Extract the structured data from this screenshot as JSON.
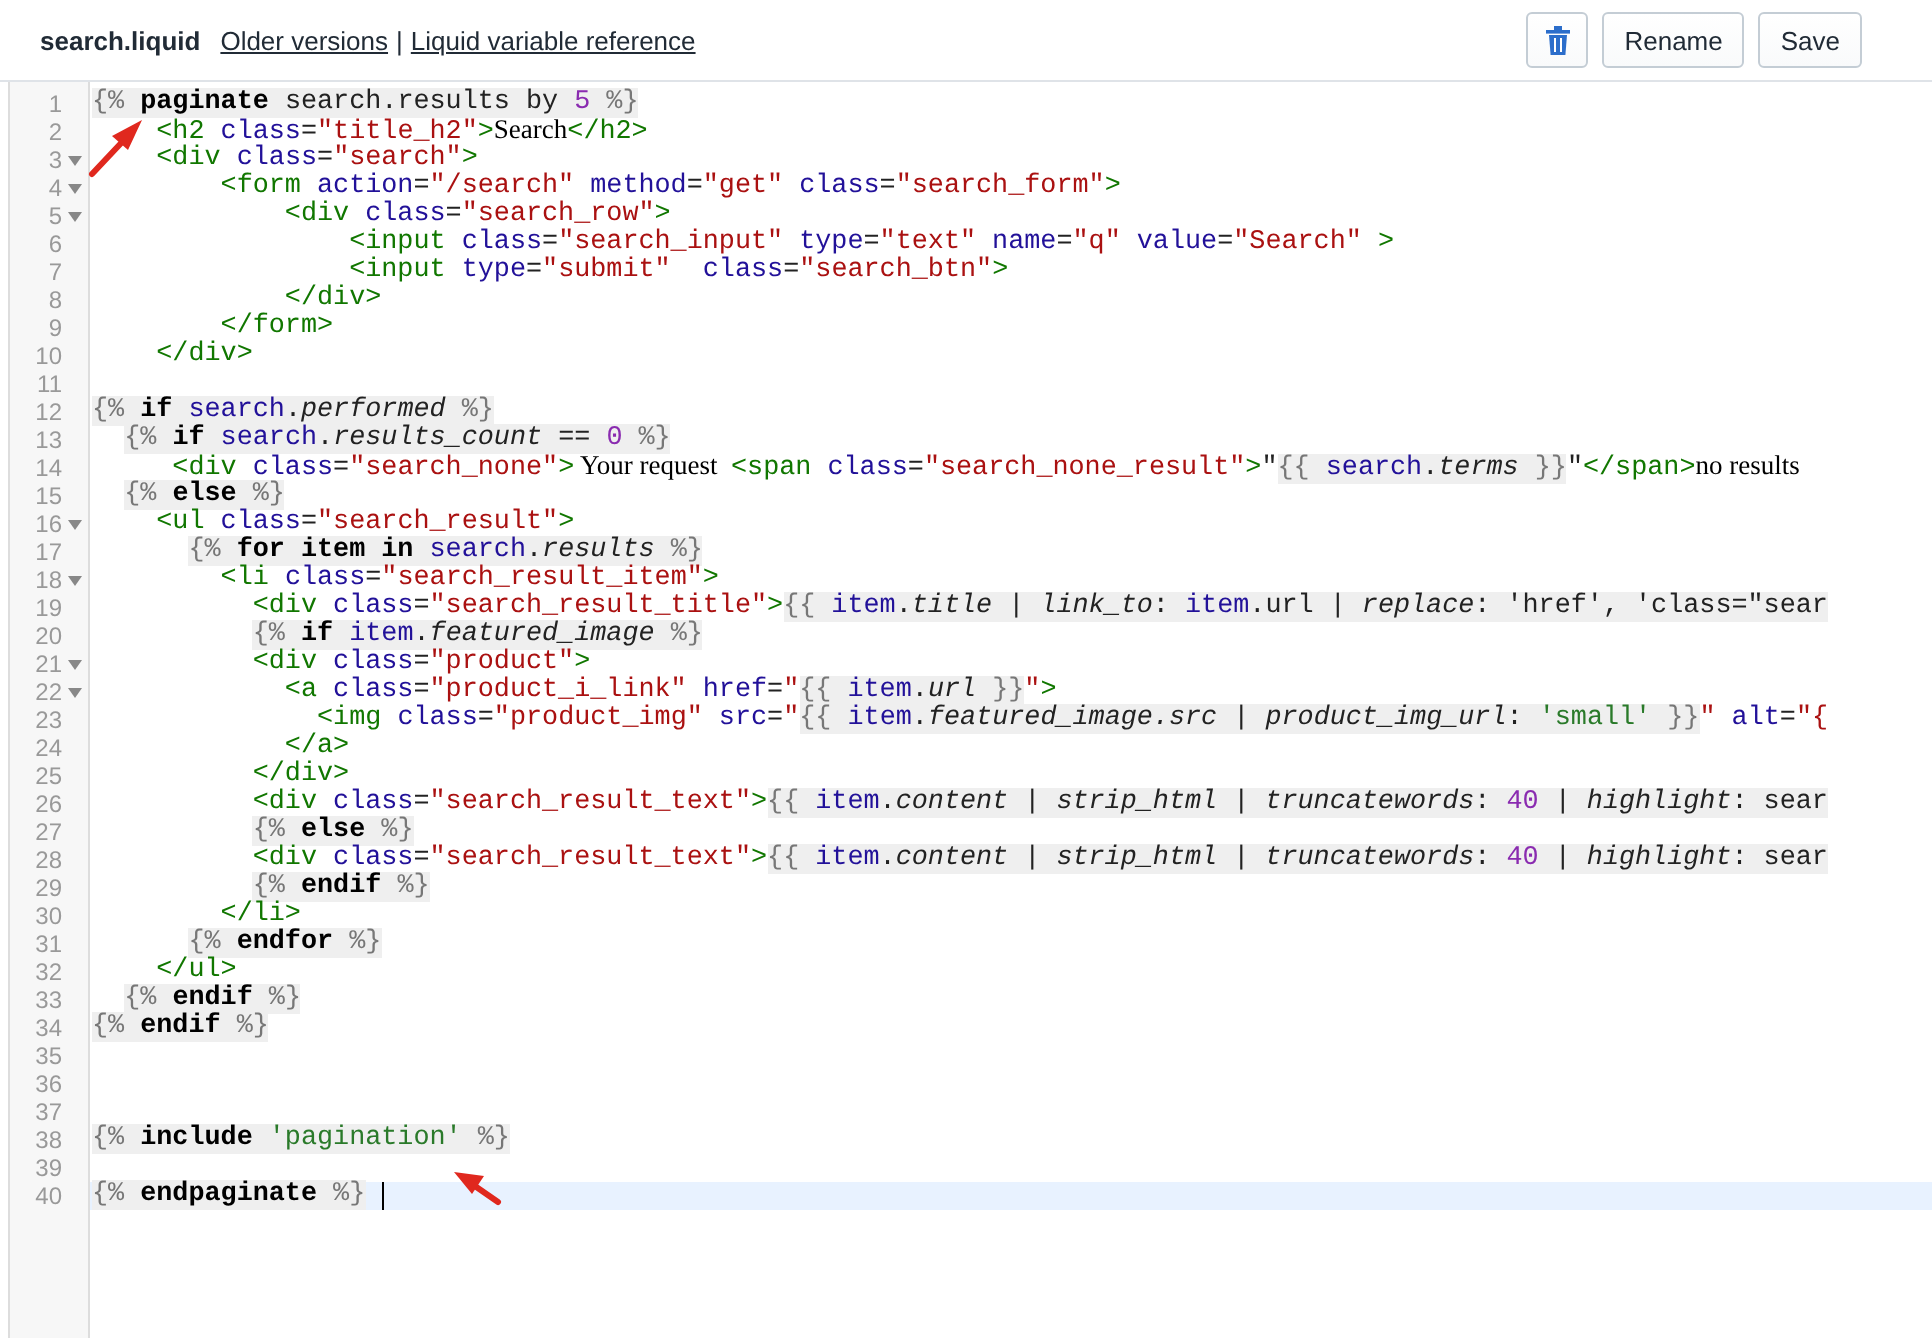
{
  "header": {
    "title": "search.liquid",
    "links": [
      {
        "label": "Older versions"
      },
      {
        "label": "Liquid variable reference"
      }
    ],
    "separator": "|",
    "buttons": [
      {
        "kind": "delete"
      },
      {
        "kind": "text",
        "label": "Rename"
      },
      {
        "kind": "text",
        "label": "Save"
      }
    ]
  },
  "editor": {
    "lines": [
      {
        "number": "1",
        "foldable": false,
        "current": false,
        "tokens": [
          {
            "kind": "block",
            "children": [
              {
                "kind": "lq",
                "text": "{% "
              },
              {
                "kind": "kw",
                "text": "paginate"
              },
              {
                "kind": "p",
                "text": " search.results by "
              },
              {
                "kind": "num",
                "text": "5"
              },
              {
                "kind": "lq",
                "text": " %}"
              }
            ]
          }
        ]
      },
      {
        "number": "2",
        "foldable": false,
        "current": false,
        "tokens": [
          {
            "kind": "tag",
            "text": "    <h2"
          },
          {
            "kind": "attr",
            "text": " class"
          },
          {
            "kind": "p",
            "text": "="
          },
          {
            "kind": "str",
            "text": "\"title_h2\""
          },
          {
            "kind": "tag",
            "text": ">"
          },
          {
            "kind": "text",
            "text": "Search"
          },
          {
            "kind": "tag",
            "text": "</h2>"
          }
        ]
      },
      {
        "number": "3",
        "foldable": true,
        "current": false,
        "tokens": [
          {
            "kind": "tag",
            "text": "    <div"
          },
          {
            "kind": "attr",
            "text": " class"
          },
          {
            "kind": "p",
            "text": "="
          },
          {
            "kind": "str",
            "text": "\"search\""
          },
          {
            "kind": "tag",
            "text": ">"
          }
        ]
      },
      {
        "number": "4",
        "foldable": true,
        "current": false,
        "tokens": [
          {
            "kind": "tag",
            "text": "        <form"
          },
          {
            "kind": "attr",
            "text": " action"
          },
          {
            "kind": "p",
            "text": "="
          },
          {
            "kind": "str",
            "text": "\"/search\""
          },
          {
            "kind": "attr",
            "text": " method"
          },
          {
            "kind": "p",
            "text": "="
          },
          {
            "kind": "str",
            "text": "\"get\""
          },
          {
            "kind": "attr",
            "text": " class"
          },
          {
            "kind": "p",
            "text": "="
          },
          {
            "kind": "str",
            "text": "\"search_form\""
          },
          {
            "kind": "tag",
            "text": ">"
          }
        ]
      },
      {
        "number": "5",
        "foldable": true,
        "current": false,
        "tokens": [
          {
            "kind": "tag",
            "text": "            <div"
          },
          {
            "kind": "attr",
            "text": " class"
          },
          {
            "kind": "p",
            "text": "="
          },
          {
            "kind": "str",
            "text": "\"search_row\""
          },
          {
            "kind": "tag",
            "text": ">"
          }
        ]
      },
      {
        "number": "6",
        "foldable": false,
        "current": false,
        "tokens": [
          {
            "kind": "tag",
            "text": "                <input"
          },
          {
            "kind": "attr",
            "text": " class"
          },
          {
            "kind": "p",
            "text": "="
          },
          {
            "kind": "str",
            "text": "\"search_input\""
          },
          {
            "kind": "attr",
            "text": " type"
          },
          {
            "kind": "p",
            "text": "="
          },
          {
            "kind": "str",
            "text": "\"text\""
          },
          {
            "kind": "attr",
            "text": " name"
          },
          {
            "kind": "p",
            "text": "="
          },
          {
            "kind": "str",
            "text": "\"q\""
          },
          {
            "kind": "attr",
            "text": " value"
          },
          {
            "kind": "p",
            "text": "="
          },
          {
            "kind": "str",
            "text": "\"Search\""
          },
          {
            "kind": "tag",
            "text": " >"
          }
        ]
      },
      {
        "number": "7",
        "foldable": false,
        "current": false,
        "tokens": [
          {
            "kind": "tag",
            "text": "                <input"
          },
          {
            "kind": "attr",
            "text": " type"
          },
          {
            "kind": "p",
            "text": "="
          },
          {
            "kind": "str",
            "text": "\"submit\""
          },
          {
            "kind": "attr",
            "text": "  class"
          },
          {
            "kind": "p",
            "text": "="
          },
          {
            "kind": "str",
            "text": "\"search_btn\""
          },
          {
            "kind": "tag",
            "text": ">"
          }
        ]
      },
      {
        "number": "8",
        "foldable": false,
        "current": false,
        "tokens": [
          {
            "kind": "tag",
            "text": "            </div>"
          }
        ]
      },
      {
        "number": "9",
        "foldable": false,
        "current": false,
        "tokens": [
          {
            "kind": "tag",
            "text": "        </form>"
          }
        ]
      },
      {
        "number": "10",
        "foldable": false,
        "current": false,
        "tokens": [
          {
            "kind": "tag",
            "text": "    </div>"
          }
        ]
      },
      {
        "number": "11",
        "foldable": false,
        "current": false
      },
      {
        "number": "12",
        "foldable": false,
        "current": false,
        "tokens": [
          {
            "kind": "block",
            "children": [
              {
                "kind": "lq",
                "text": "{% "
              },
              {
                "kind": "kw",
                "text": "if"
              },
              {
                "kind": "var",
                "text": " search"
              },
              {
                "kind": "p",
                "text": "."
              },
              {
                "kind": "prop",
                "text": "performed"
              },
              {
                "kind": "lq",
                "text": " %}"
              }
            ]
          }
        ]
      },
      {
        "number": "13",
        "foldable": false,
        "current": false,
        "tokens": [
          {
            "kind": "block",
            "children": [
              {
                "kind": "lq",
                "text": "  {% "
              },
              {
                "kind": "kw",
                "text": "if"
              },
              {
                "kind": "var",
                "text": " search"
              },
              {
                "kind": "p",
                "text": "."
              },
              {
                "kind": "prop",
                "text": "results_count"
              },
              {
                "kind": "p",
                "text": " == "
              },
              {
                "kind": "num",
                "text": "0"
              },
              {
                "kind": "lq",
                "text": " %}"
              }
            ]
          }
        ]
      },
      {
        "number": "14",
        "foldable": false,
        "current": false,
        "tokens": [
          {
            "kind": "tag",
            "text": "     <div"
          },
          {
            "kind": "attr",
            "text": " class"
          },
          {
            "kind": "p",
            "text": "="
          },
          {
            "kind": "str",
            "text": "\"search_none\""
          },
          {
            "kind": "tag",
            "text": ">"
          },
          {
            "kind": "text",
            "text": " Your request  "
          },
          {
            "kind": "tag",
            "text": "<span"
          },
          {
            "kind": "attr",
            "text": " class"
          },
          {
            "kind": "p",
            "text": "="
          },
          {
            "kind": "str",
            "text": "\"search_none_result\""
          },
          {
            "kind": "tag",
            "text": ">"
          },
          {
            "kind": "p",
            "text": "\""
          },
          {
            "kind": "block",
            "children": [
              {
                "kind": "lq",
                "text": "{{ "
              },
              {
                "kind": "var",
                "text": "search"
              },
              {
                "kind": "p",
                "text": "."
              },
              {
                "kind": "prop",
                "text": "terms"
              },
              {
                "kind": "lq",
                "text": " }}"
              }
            ]
          },
          {
            "kind": "p",
            "text": "\""
          },
          {
            "kind": "tag",
            "text": "</span>"
          },
          {
            "kind": "text",
            "text": "no results"
          }
        ]
      },
      {
        "number": "15",
        "foldable": false,
        "current": false,
        "tokens": [
          {
            "kind": "block",
            "children": [
              {
                "kind": "lq",
                "text": "  {% "
              },
              {
                "kind": "kw",
                "text": "else"
              },
              {
                "kind": "lq",
                "text": " %}"
              }
            ]
          }
        ]
      },
      {
        "number": "16",
        "foldable": true,
        "current": false,
        "tokens": [
          {
            "kind": "tag",
            "text": "    <ul"
          },
          {
            "kind": "attr",
            "text": " class"
          },
          {
            "kind": "p",
            "text": "="
          },
          {
            "kind": "str",
            "text": "\"search_result\""
          },
          {
            "kind": "tag",
            "text": ">"
          }
        ]
      },
      {
        "number": "17",
        "foldable": false,
        "current": false,
        "tokens": [
          {
            "kind": "block",
            "children": [
              {
                "kind": "lq",
                "text": "      {% "
              },
              {
                "kind": "kw",
                "text": "for item in"
              },
              {
                "kind": "var",
                "text": " search"
              },
              {
                "kind": "p",
                "text": "."
              },
              {
                "kind": "prop",
                "text": "results"
              },
              {
                "kind": "lq",
                "text": " %}"
              }
            ]
          }
        ]
      },
      {
        "number": "18",
        "foldable": true,
        "current": false,
        "tokens": [
          {
            "kind": "tag",
            "text": "        <li"
          },
          {
            "kind": "attr",
            "text": " class"
          },
          {
            "kind": "p",
            "text": "="
          },
          {
            "kind": "str",
            "text": "\"search_result_item\""
          },
          {
            "kind": "tag",
            "text": ">"
          }
        ]
      },
      {
        "number": "19",
        "foldable": false,
        "current": false,
        "tokens": [
          {
            "kind": "tag",
            "text": "          <div"
          },
          {
            "kind": "attr",
            "text": " class"
          },
          {
            "kind": "p",
            "text": "="
          },
          {
            "kind": "str",
            "text": "\"search_result_title\""
          },
          {
            "kind": "tag",
            "text": ">"
          },
          {
            "kind": "block",
            "children": [
              {
                "kind": "lq",
                "text": "{{ "
              },
              {
                "kind": "var",
                "text": "item"
              },
              {
                "kind": "p",
                "text": "."
              },
              {
                "kind": "prop",
                "text": "title"
              },
              {
                "kind": "p",
                "text": " | "
              },
              {
                "kind": "prop",
                "text": "link_to"
              },
              {
                "kind": "p",
                "text": ": "
              },
              {
                "kind": "var",
                "text": "item"
              },
              {
                "kind": "p",
                "text": ".url | "
              },
              {
                "kind": "prop",
                "text": "replace"
              },
              {
                "kind": "p",
                "text": ": 'href', 'class=\"sear"
              }
            ]
          }
        ]
      },
      {
        "number": "20",
        "foldable": false,
        "current": false,
        "tokens": [
          {
            "kind": "block",
            "children": [
              {
                "kind": "lq",
                "text": "          {% "
              },
              {
                "kind": "kw",
                "text": "if"
              },
              {
                "kind": "var",
                "text": " item"
              },
              {
                "kind": "p",
                "text": "."
              },
              {
                "kind": "prop",
                "text": "featured_image"
              },
              {
                "kind": "lq",
                "text": " %}"
              }
            ]
          }
        ]
      },
      {
        "number": "21",
        "foldable": true,
        "current": false,
        "tokens": [
          {
            "kind": "tag",
            "text": "          <div"
          },
          {
            "kind": "attr",
            "text": " class"
          },
          {
            "kind": "p",
            "text": "="
          },
          {
            "kind": "str",
            "text": "\"product\""
          },
          {
            "kind": "tag",
            "text": ">"
          }
        ]
      },
      {
        "number": "22",
        "foldable": true,
        "current": false,
        "tokens": [
          {
            "kind": "tag",
            "text": "            <a"
          },
          {
            "kind": "attr",
            "text": " class"
          },
          {
            "kind": "p",
            "text": "="
          },
          {
            "kind": "str",
            "text": "\"product_i_link\""
          },
          {
            "kind": "attr",
            "text": " href"
          },
          {
            "kind": "p",
            "text": "="
          },
          {
            "kind": "str",
            "text": "\""
          },
          {
            "kind": "block",
            "children": [
              {
                "kind": "lq",
                "text": "{{ "
              },
              {
                "kind": "var",
                "text": "item"
              },
              {
                "kind": "p",
                "text": "."
              },
              {
                "kind": "prop",
                "text": "url"
              },
              {
                "kind": "lq",
                "text": " }}"
              }
            ]
          },
          {
            "kind": "str",
            "text": "\""
          },
          {
            "kind": "tag",
            "text": ">"
          }
        ]
      },
      {
        "number": "23",
        "foldable": false,
        "current": false,
        "tokens": [
          {
            "kind": "tag",
            "text": "              <img"
          },
          {
            "kind": "attr",
            "text": " class"
          },
          {
            "kind": "p",
            "text": "="
          },
          {
            "kind": "str",
            "text": "\"product_img\""
          },
          {
            "kind": "attr",
            "text": " src"
          },
          {
            "kind": "p",
            "text": "="
          },
          {
            "kind": "str",
            "text": "\""
          },
          {
            "kind": "block",
            "children": [
              {
                "kind": "lq",
                "text": "{{ "
              },
              {
                "kind": "var",
                "text": "item"
              },
              {
                "kind": "p",
                "text": "."
              },
              {
                "kind": "prop",
                "text": "featured_image.src"
              },
              {
                "kind": "p",
                "text": " | "
              },
              {
                "kind": "prop",
                "text": "product_img_url"
              },
              {
                "kind": "p",
                "text": ": "
              },
              {
                "kind": "lstr",
                "text": "'small'"
              },
              {
                "kind": "lq",
                "text": " }}"
              }
            ]
          },
          {
            "kind": "str",
            "text": "\""
          },
          {
            "kind": "attr",
            "text": " alt"
          },
          {
            "kind": "p",
            "text": "="
          },
          {
            "kind": "str",
            "text": "\"{"
          }
        ]
      },
      {
        "number": "24",
        "foldable": false,
        "current": false,
        "tokens": [
          {
            "kind": "tag",
            "text": "            </a>"
          }
        ]
      },
      {
        "number": "25",
        "foldable": false,
        "current": false,
        "tokens": [
          {
            "kind": "tag",
            "text": "          </div>"
          }
        ]
      },
      {
        "number": "26",
        "foldable": false,
        "current": false,
        "tokens": [
          {
            "kind": "tag",
            "text": "          <div"
          },
          {
            "kind": "attr",
            "text": " class"
          },
          {
            "kind": "p",
            "text": "="
          },
          {
            "kind": "str",
            "text": "\"search_result_text\""
          },
          {
            "kind": "tag",
            "text": ">"
          },
          {
            "kind": "block",
            "children": [
              {
                "kind": "lq",
                "text": "{{ "
              },
              {
                "kind": "var",
                "text": "item"
              },
              {
                "kind": "p",
                "text": "."
              },
              {
                "kind": "prop",
                "text": "content"
              },
              {
                "kind": "p",
                "text": " | "
              },
              {
                "kind": "prop",
                "text": "strip_html"
              },
              {
                "kind": "p",
                "text": " | "
              },
              {
                "kind": "prop",
                "text": "truncatewords"
              },
              {
                "kind": "p",
                "text": ": "
              },
              {
                "kind": "num",
                "text": "40"
              },
              {
                "kind": "p",
                "text": " | "
              },
              {
                "kind": "prop",
                "text": "highlight"
              },
              {
                "kind": "p",
                "text": ": sear"
              }
            ]
          }
        ]
      },
      {
        "number": "27",
        "foldable": false,
        "current": false,
        "tokens": [
          {
            "kind": "block",
            "children": [
              {
                "kind": "lq",
                "text": "          {% "
              },
              {
                "kind": "kw",
                "text": "else"
              },
              {
                "kind": "lq",
                "text": " %}"
              }
            ]
          }
        ]
      },
      {
        "number": "28",
        "foldable": false,
        "current": false,
        "tokens": [
          {
            "kind": "tag",
            "text": "          <div"
          },
          {
            "kind": "attr",
            "text": " class"
          },
          {
            "kind": "p",
            "text": "="
          },
          {
            "kind": "str",
            "text": "\"search_result_text\""
          },
          {
            "kind": "tag",
            "text": ">"
          },
          {
            "kind": "block",
            "children": [
              {
                "kind": "lq",
                "text": "{{ "
              },
              {
                "kind": "var",
                "text": "item"
              },
              {
                "kind": "p",
                "text": "."
              },
              {
                "kind": "prop",
                "text": "content"
              },
              {
                "kind": "p",
                "text": " | "
              },
              {
                "kind": "prop",
                "text": "strip_html"
              },
              {
                "kind": "p",
                "text": " | "
              },
              {
                "kind": "prop",
                "text": "truncatewords"
              },
              {
                "kind": "p",
                "text": ": "
              },
              {
                "kind": "num",
                "text": "40"
              },
              {
                "kind": "p",
                "text": " | "
              },
              {
                "kind": "prop",
                "text": "highlight"
              },
              {
                "kind": "p",
                "text": ": sear"
              }
            ]
          }
        ]
      },
      {
        "number": "29",
        "foldable": false,
        "current": false,
        "tokens": [
          {
            "kind": "block",
            "children": [
              {
                "kind": "lq",
                "text": "          {% "
              },
              {
                "kind": "kw",
                "text": "endif"
              },
              {
                "kind": "lq",
                "text": " %}"
              }
            ]
          }
        ]
      },
      {
        "number": "30",
        "foldable": false,
        "current": false,
        "tokens": [
          {
            "kind": "tag",
            "text": "        </li>"
          }
        ]
      },
      {
        "number": "31",
        "foldable": false,
        "current": false,
        "tokens": [
          {
            "kind": "block",
            "children": [
              {
                "kind": "lq",
                "text": "      {% "
              },
              {
                "kind": "kw",
                "text": "endfor"
              },
              {
                "kind": "lq",
                "text": " %}"
              }
            ]
          }
        ]
      },
      {
        "number": "32",
        "foldable": false,
        "current": false,
        "tokens": [
          {
            "kind": "tag",
            "text": "    </ul>"
          }
        ]
      },
      {
        "number": "33",
        "foldable": false,
        "current": false,
        "tokens": [
          {
            "kind": "block",
            "children": [
              {
                "kind": "lq",
                "text": "  {% "
              },
              {
                "kind": "kw",
                "text": "endif"
              },
              {
                "kind": "lq",
                "text": " %}"
              }
            ]
          }
        ]
      },
      {
        "number": "34",
        "foldable": false,
        "current": false,
        "tokens": [
          {
            "kind": "block",
            "children": [
              {
                "kind": "lq",
                "text": "{% "
              },
              {
                "kind": "kw",
                "text": "endif"
              },
              {
                "kind": "lq",
                "text": " %}"
              }
            ]
          }
        ]
      },
      {
        "number": "35",
        "foldable": false,
        "current": false
      },
      {
        "number": "36",
        "foldable": false,
        "current": false
      },
      {
        "number": "37",
        "foldable": false,
        "current": false
      },
      {
        "number": "38",
        "foldable": false,
        "current": false,
        "tokens": [
          {
            "kind": "block",
            "children": [
              {
                "kind": "lq",
                "text": "{% "
              },
              {
                "kind": "kw",
                "text": "include"
              },
              {
                "kind": "lstr",
                "text": " 'pagination'"
              },
              {
                "kind": "lq",
                "text": " %}"
              }
            ]
          }
        ]
      },
      {
        "number": "39",
        "foldable": false,
        "current": false
      },
      {
        "number": "40",
        "foldable": false,
        "current": true,
        "tokens": [
          {
            "kind": "block",
            "children": [
              {
                "kind": "lq",
                "text": "{% "
              },
              {
                "kind": "kw",
                "text": "endpaginate"
              },
              {
                "kind": "lq",
                "text": " %}"
              }
            ]
          }
        ]
      }
    ]
  }
}
